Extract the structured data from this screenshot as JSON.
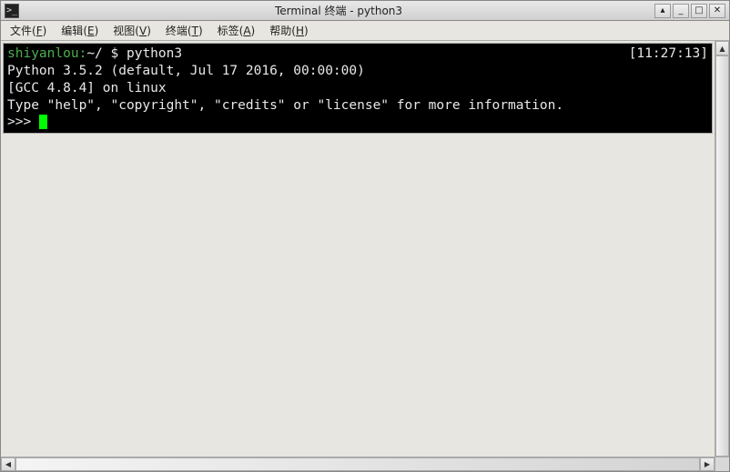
{
  "window": {
    "title": "Terminal 终端 - python3"
  },
  "menubar": {
    "items": [
      {
        "label": "文件",
        "key": "F"
      },
      {
        "label": "编辑",
        "key": "E"
      },
      {
        "label": "视图",
        "key": "V"
      },
      {
        "label": "终端",
        "key": "T"
      },
      {
        "label": "标签",
        "key": "A"
      },
      {
        "label": "帮助",
        "key": "H"
      }
    ]
  },
  "terminal": {
    "prompt_user": "shiyanlou:",
    "prompt_path": "~/",
    "prompt_symbol": " $ ",
    "command": "python3",
    "clock": "[11:27:13]",
    "lines": [
      "Python 3.5.2 (default, Jul 17 2016, 00:00:00)",
      "[GCC 4.8.4] on linux",
      "Type \"help\", \"copyright\", \"credits\" or \"license\" for more information."
    ],
    "repl_prompt": ">>> "
  }
}
